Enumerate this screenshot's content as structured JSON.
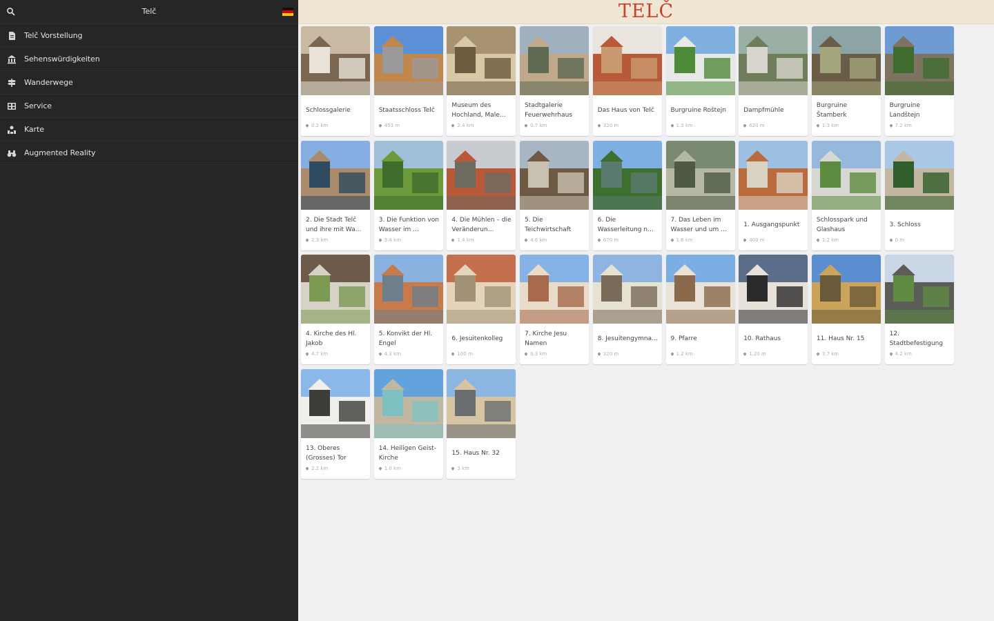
{
  "sidebar": {
    "search_icon": "search-icon",
    "title": "Telč",
    "language_flag": "germany-flag-icon",
    "items": [
      {
        "icon": "document-icon",
        "label": "Telč Vorstellung"
      },
      {
        "icon": "museum-icon",
        "label": "Sehenswürdigkeiten"
      },
      {
        "icon": "signpost-icon",
        "label": "Wanderwege"
      },
      {
        "icon": "service-grid-icon",
        "label": "Service"
      },
      {
        "icon": "map-icon",
        "label": "Karte"
      },
      {
        "icon": "binoculars-icon",
        "label": "Augmented Reality"
      }
    ]
  },
  "header": {
    "brand": "TELČ",
    "brand_color": "#c9402f",
    "bar_color": "#efe7d3"
  },
  "cards": [
    {
      "title": "Schlossgalerie",
      "distance": "0.2 km"
    },
    {
      "title": "Staatsschloss Telč",
      "distance": "453 m"
    },
    {
      "title": "Museum des Hochland, Male…",
      "distance": "2.4 km"
    },
    {
      "title": "Stadtgalerie Feuerwehrhaus",
      "distance": "0.7 km"
    },
    {
      "title": "Das Haus von Telč",
      "distance": "320 m"
    },
    {
      "title": "Burgruine Roštejn",
      "distance": "1.3 km"
    },
    {
      "title": "Dampfmühle",
      "distance": "620 m"
    },
    {
      "title": "Burgruine Štamberk",
      "distance": "1.3 km"
    },
    {
      "title": "Burgruine Landštejn",
      "distance": "7.2 km"
    },
    {
      "title": "2. Die Stadt Telč und ihre mit Wa…",
      "distance": "2.3 km"
    },
    {
      "title": "3. Die Funktion von Wasser im …",
      "distance": "3.4 km"
    },
    {
      "title": "4. Die Mühlen – die Veränderun…",
      "distance": "1.4 km"
    },
    {
      "title": "5. Die Teichwirtschaft",
      "distance": "4.6 km"
    },
    {
      "title": "6. Die Wasserleitung n…",
      "distance": "670 m"
    },
    {
      "title": "7. Das Leben im Wasser und um …",
      "distance": "1.6 km"
    },
    {
      "title": "1. Ausgangspunkt",
      "distance": "400 m"
    },
    {
      "title": "Schlosspark und Glashaus",
      "distance": "1.2 km"
    },
    {
      "title": "3. Schloss",
      "distance": "0 m"
    },
    {
      "title": "4. Kirche des Hl. Jakob",
      "distance": "4.7 km"
    },
    {
      "title": "5. Konvikt der Hl. Engel",
      "distance": "4.3 km"
    },
    {
      "title": "6. Jesuitenkolleg",
      "distance": "100 m"
    },
    {
      "title": "7. Kirche Jesu Namen",
      "distance": "0.3 km"
    },
    {
      "title": "8. Jesuitengymna…",
      "distance": "320 m"
    },
    {
      "title": "9. Pfarre",
      "distance": "1.2 km"
    },
    {
      "title": "10. Rathaus",
      "distance": "1.20 m"
    },
    {
      "title": "11. Haus Nr. 15",
      "distance": "3.7 km"
    },
    {
      "title": "12. Stadtbefestigung",
      "distance": "4.2 km"
    },
    {
      "title": "13. Oberes (Grosses) Tor",
      "distance": "2.2 km"
    },
    {
      "title": "14. Heiligen Geist-Kirche",
      "distance": "1.0 km"
    },
    {
      "title": "15. Haus Nr. 32",
      "distance": "3 km"
    }
  ]
}
